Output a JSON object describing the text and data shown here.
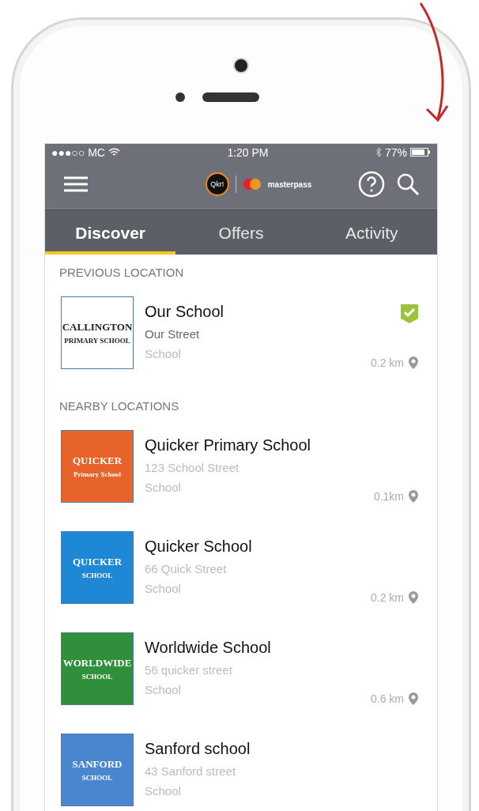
{
  "status_bar": {
    "carrier": "●●●○○ MC",
    "time": "1:20 PM",
    "battery": "77%"
  },
  "header": {
    "brand_left": "Qkr!",
    "brand_right": "masterpass"
  },
  "tabs": [
    {
      "label": "Discover",
      "selected": true
    },
    {
      "label": "Offers",
      "selected": false
    },
    {
      "label": "Activity",
      "selected": false
    }
  ],
  "sections": [
    {
      "title": "PREVIOUS LOCATION",
      "items": [
        {
          "name": "Our School",
          "address": "Our Street",
          "type": "School",
          "distance": "0.2 km",
          "checked": true,
          "address_dark": true,
          "logo": {
            "color": "#ffffff",
            "lines": [
              "CALLINGTON",
              "PRIMARY SCHOOL"
            ]
          }
        }
      ]
    },
    {
      "title": "NEARBY LOCATIONS",
      "items": [
        {
          "name": "Quicker Primary School",
          "address": "123 School Street",
          "type": "School",
          "distance": "0.1km",
          "checked": false,
          "address_dark": false,
          "logo": {
            "color": "#e8632a",
            "lines": [
              "QUICKER",
              "Primary School"
            ]
          }
        },
        {
          "name": "Quicker School",
          "address": "66 Quick Street",
          "type": "School",
          "distance": "0.2 km",
          "checked": false,
          "address_dark": false,
          "logo": {
            "color": "#1e88d6",
            "lines": [
              "QUICKER",
              "SCHOOL"
            ]
          }
        },
        {
          "name": "Worldwide School",
          "address": "56 quicker street",
          "type": "School",
          "distance": "0.6 km",
          "checked": false,
          "address_dark": false,
          "logo": {
            "color": "#2f8f3a",
            "lines": [
              "WORLDWIDE",
              "SCHOOL"
            ]
          }
        },
        {
          "name": "Sanford school",
          "address": "43 Sanford street",
          "type": "School",
          "checked": false,
          "address_dark": false,
          "logo": {
            "color": "#4a86d0",
            "lines": [
              "SANFORD",
              "SCHOOL"
            ]
          }
        }
      ]
    }
  ]
}
